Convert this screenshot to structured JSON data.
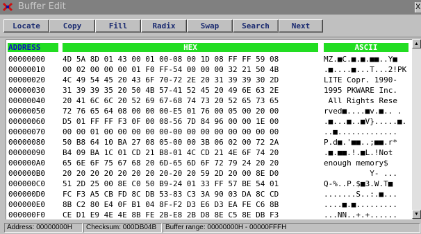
{
  "window": {
    "title": "Buffer Edit",
    "close_label": "X"
  },
  "toolbar": {
    "buttons": [
      {
        "label": "Locate"
      },
      {
        "label": "Copy"
      },
      {
        "label": "Fill"
      },
      {
        "label": "Radix"
      },
      {
        "label": "Swap"
      },
      {
        "label": "Search"
      },
      {
        "label": "Next"
      }
    ]
  },
  "headers": {
    "address": "ADDRESS",
    "hex": "HEX",
    "ascii": "ASCII"
  },
  "rows": [
    {
      "address": "00000000",
      "hex": "4D 5A 8D 01 43 00 01 00-08 00 1D 08 FF FF 59 08",
      "ascii": "MZ.■C.■.■.■■..Y■"
    },
    {
      "address": "00000010",
      "hex": "00 02 00 00 00 01 F0 FF-54 00 00 00 32 21 50 4B",
      "ascii": ".■....■...T...2!PK"
    },
    {
      "address": "00000020",
      "hex": "4C 49 54 45 20 43 6F 70-72 2E 20 31 39 39 30 2D",
      "ascii": "LITE Copr. 1990-"
    },
    {
      "address": "00000030",
      "hex": "31 39 39 35 20 50 4B 57-41 52 45 20 49 6E 63 2E",
      "ascii": "1995 PKWARE Inc."
    },
    {
      "address": "00000040",
      "hex": "20 41 6C 6C 20 52 69 67-68 74 73 20 52 65 73 65",
      "ascii": " All Rights Rese"
    },
    {
      "address": "00000050",
      "hex": "72 76 65 64 08 00 00 00-E5 01 76 00 05 00 20 00",
      "ascii": "rved■....■v.■.. ."
    },
    {
      "address": "00000060",
      "hex": "D5 01 FF FF F3 0F 00 08-56 7D 84 96 00 00 1E 00",
      "ascii": ".■...■..■V}.....■."
    },
    {
      "address": "00000070",
      "hex": "00 00 01 00 00 00 00 00-00 00 00 00 00 00 00 00",
      "ascii": "..■............."
    },
    {
      "address": "00000080",
      "hex": "50 B8 64 10 BA 27 08 05-00 00 3B 06 02 00 72 2A",
      "ascii": "P.d■.'■■..;■■.r*"
    },
    {
      "address": "00000090",
      "hex": "B4 09 BA 1C 01 CD 21 B8-01 4C CD 21 4E 6F 74 20",
      "ascii": ".■.■■.!.■L.!Not "
    },
    {
      "address": "000000A0",
      "hex": "65 6E 6F 75 67 68 20 6D-65 6D 6F 72 79 24 20 20",
      "ascii": "enough memory$  "
    },
    {
      "address": "000000B0",
      "hex": "20 20 20 20 20 20 20 20-20 20 59 2D 20 00 8E D0",
      "ascii": "          Y- ..."
    },
    {
      "address": "000000C0",
      "hex": "51 2D 25 00 8E C0 50 B9-24 01 33 FF 57 BE 54 01",
      "ascii": "Q-%..P.$■3.W.T■"
    },
    {
      "address": "000000D0",
      "hex": "FC F3 A5 CB FD 8C DB 53-83 C3 3A 90 03 DA 8C CD",
      "ascii": ".......S..:.■..."
    },
    {
      "address": "000000E0",
      "hex": "8B C2 80 E4 0F B1 04 8F-F2 D3 E6 D3 EA FE C6 8B",
      "ascii": "....■.■........."
    },
    {
      "address": "000000F0",
      "hex": "CE D1 E9 4E 4E 8B FE 2B-E8 2B D8 8E C5 8E DB F3",
      "ascii": "...NN..+.+......"
    }
  ],
  "status": {
    "address": "Address: 00000000H",
    "checksum": "Checksum: 000DB04B",
    "range": "Buffer range: 00000000H - 00000FFFH"
  },
  "colors": {
    "header_green": "#22dd22",
    "address_blue": "#1010c0",
    "button_text": "#1a2a70"
  }
}
